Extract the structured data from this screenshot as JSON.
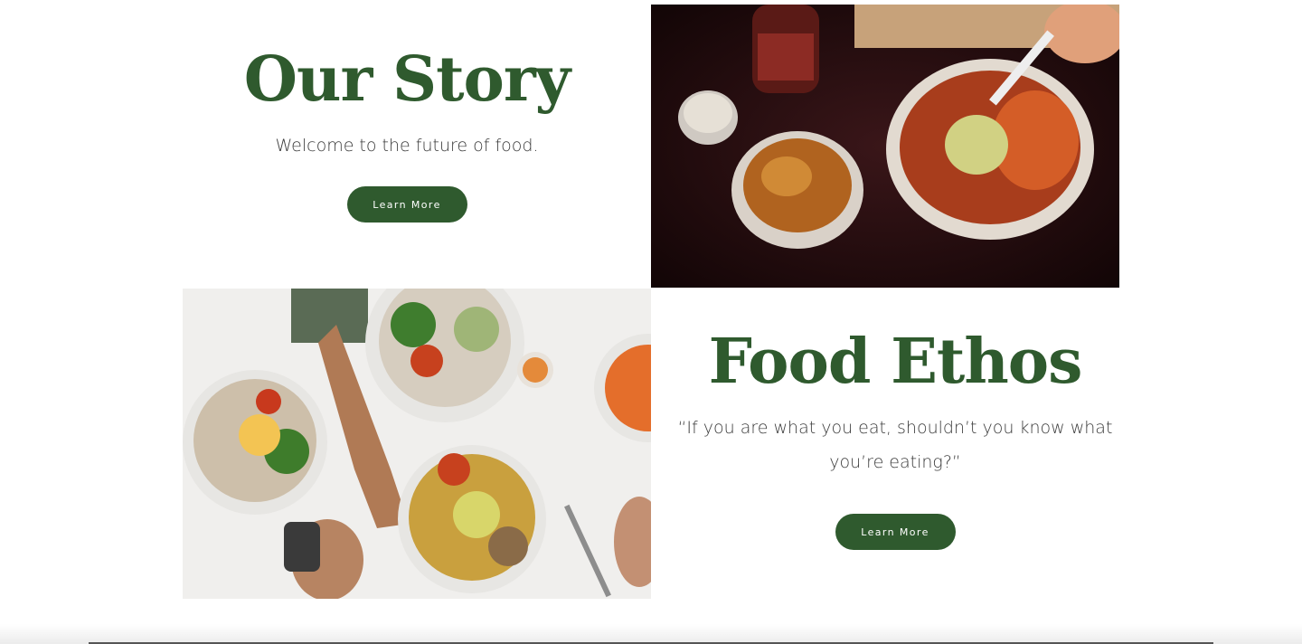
{
  "story": {
    "title": "Our Story",
    "subtitle": "Welcome to the future of food.",
    "button_label": "Learn More"
  },
  "ethos": {
    "title": "Food Ethos",
    "quote_line1": "“If you are what you eat, shouldn’t you know what",
    "quote_line2": "you’re eating?”",
    "button_label": "Learn More"
  },
  "images": {
    "top_photo": "takeout-bowls-dark-table-photo",
    "bottom_photo": "salad-bowls-overhead-photo"
  },
  "colors": {
    "brand_green": "#2f5a2e",
    "text": "#3b3b3b",
    "background": "#ffffff"
  }
}
